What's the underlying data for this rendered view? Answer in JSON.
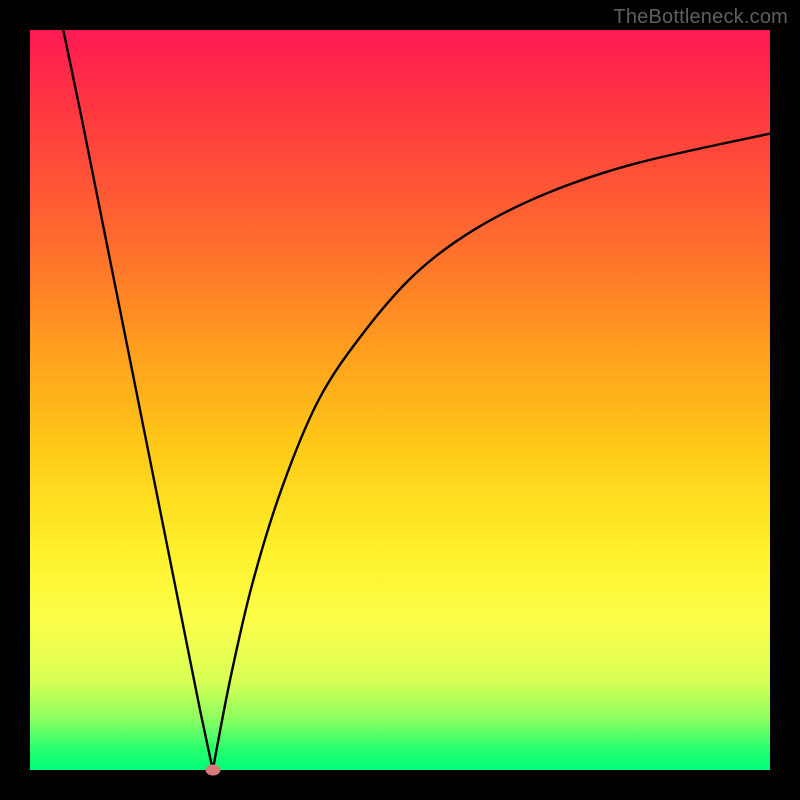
{
  "attribution": "TheBottleneck.com",
  "chart_data": {
    "type": "line",
    "title": "",
    "xlabel": "",
    "ylabel": "",
    "xlim": [
      0,
      100
    ],
    "ylim": [
      0,
      100
    ],
    "gradient_note": "background vertical gradient red→orange→yellow→green (top→bottom)",
    "series": [
      {
        "name": "left-branch",
        "x": [
          4.5,
          7,
          9,
          11,
          13,
          15,
          17,
          19,
          21,
          23,
          24.7
        ],
        "values": [
          100,
          88,
          78,
          68,
          58,
          48,
          38,
          28,
          18,
          8,
          0
        ]
      },
      {
        "name": "right-branch",
        "x": [
          24.7,
          27,
          30,
          34,
          39,
          45,
          52,
          60,
          70,
          82,
          100
        ],
        "values": [
          0,
          12,
          25,
          38,
          50,
          59,
          67,
          73,
          78,
          82,
          86
        ]
      }
    ],
    "marker": {
      "x": 24.7,
      "y": 0,
      "color": "#d97a7a"
    }
  }
}
